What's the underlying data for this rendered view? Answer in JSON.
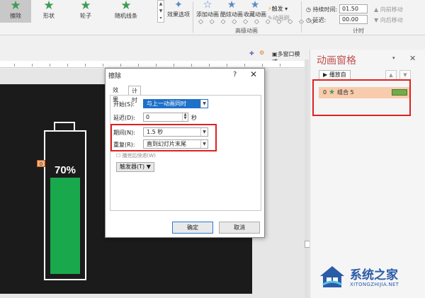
{
  "ribbon": {
    "effects": [
      "擦除",
      "形状",
      "轮子",
      "随机线条"
    ],
    "effect_options_label": "效果选项",
    "add_animation": "添加动画",
    "animation_pane": "酷炫动画",
    "favorite_animation": "收藏动画",
    "trigger": "触发",
    "anim_painter": "动画刷",
    "advanced_group": "高级动画",
    "duration_label": "持续时间:",
    "duration_value": "01.50",
    "delay_label": "延迟:",
    "delay_value": "00.00",
    "move_earlier": "向前移动",
    "move_later": "向后移动",
    "timing_group": "计时"
  },
  "toolbar2": {
    "multi_window": "多窗口模式"
  },
  "slide": {
    "percent": "70%",
    "anim_tag": "0",
    "fill_level": 0.7
  },
  "dialog": {
    "title": "擦除",
    "help": "?",
    "close": "✕",
    "tabs": [
      "效果",
      "计时"
    ],
    "start_label": "开始(S):",
    "start_value": "与上一动画同时",
    "delay_label": "延迟(D):",
    "delay_value": "0",
    "delay_unit": "秒",
    "duration_label": "期间(N):",
    "duration_value": "1.5 秒",
    "repeat_label": "重复(R):",
    "repeat_value": "直到幻灯片末尾",
    "rewind_label": "播完后快退(W)",
    "trigger_label": "触发器(T)",
    "ok": "确定",
    "cancel": "取消"
  },
  "pane": {
    "title": "动画窗格",
    "play": "播放自",
    "item_number": "0",
    "item_name": "组合 5"
  },
  "watermark": {
    "main": "系统之家",
    "sub": "XITONGZHIJIA.NET"
  },
  "colors": {
    "accent": "#1aa84d",
    "highlight": "#e02020",
    "pane_title": "#c0504d"
  }
}
